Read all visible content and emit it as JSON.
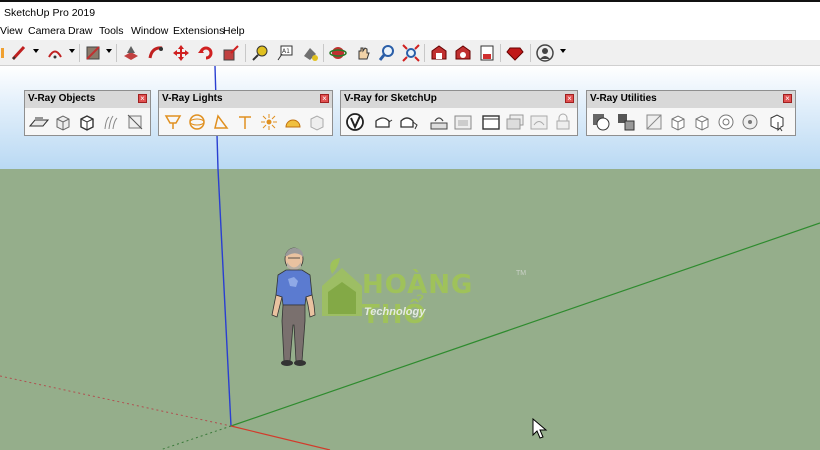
{
  "app": {
    "title": "SketchUp Pro 2019"
  },
  "menu": [
    "View",
    "Camera",
    "Draw",
    "Tools",
    "Window",
    "Extensions",
    "Help"
  ],
  "toolbar": {
    "icons": [
      "pencil-icon",
      "arc-icon",
      "paint-bucket-icon",
      "push-pull-icon",
      "follow-me-icon",
      "move-icon",
      "rotate-icon",
      "scale-icon",
      "tape-measure-icon",
      "text-icon",
      "paint-icon",
      "orbit-icon",
      "pan-icon",
      "zoom-icon",
      "zoom-extents-icon",
      "warehouse-icon",
      "extension-warehouse-icon",
      "layout-icon",
      "ruby-icon",
      "account-icon"
    ]
  },
  "palettes": [
    {
      "title": "V-Ray Objects",
      "icons": [
        "vray-plane-icon",
        "vray-box-icon",
        "vray-proxy-icon",
        "vray-fur-icon",
        "vray-clipper-icon"
      ]
    },
    {
      "title": "V-Ray Lights",
      "icons": [
        "rect-light-icon",
        "sphere-light-icon",
        "spot-light-icon",
        "ies-light-icon",
        "omni-light-icon",
        "dome-light-icon",
        "mesh-light-icon"
      ]
    },
    {
      "title": "V-Ray for SketchUp",
      "icons": [
        "vray-logo-icon",
        "render-icon",
        "interactive-render-icon",
        "render-cloud-icon",
        "frame-buffer-icon",
        "frame-icon",
        "batch-icon",
        "lock-icon"
      ]
    },
    {
      "title": "V-Ray Utilities",
      "icons": [
        "material-icon",
        "proxy-export-icon",
        "unwrap-icon",
        "cube-a-icon",
        "cube-b-icon",
        "texture-icon",
        "sphere-icon",
        "pick-icon"
      ]
    }
  ],
  "watermark": {
    "brand": "HOÀNG THỔ",
    "sub": "Technology",
    "tm": "TM"
  },
  "colors": {
    "sky": "#c3def4",
    "ground": "#95ae8b",
    "red_axis": "#d23b2b",
    "green_axis": "#2e8b2e",
    "blue_axis": "#2a3fd1"
  }
}
